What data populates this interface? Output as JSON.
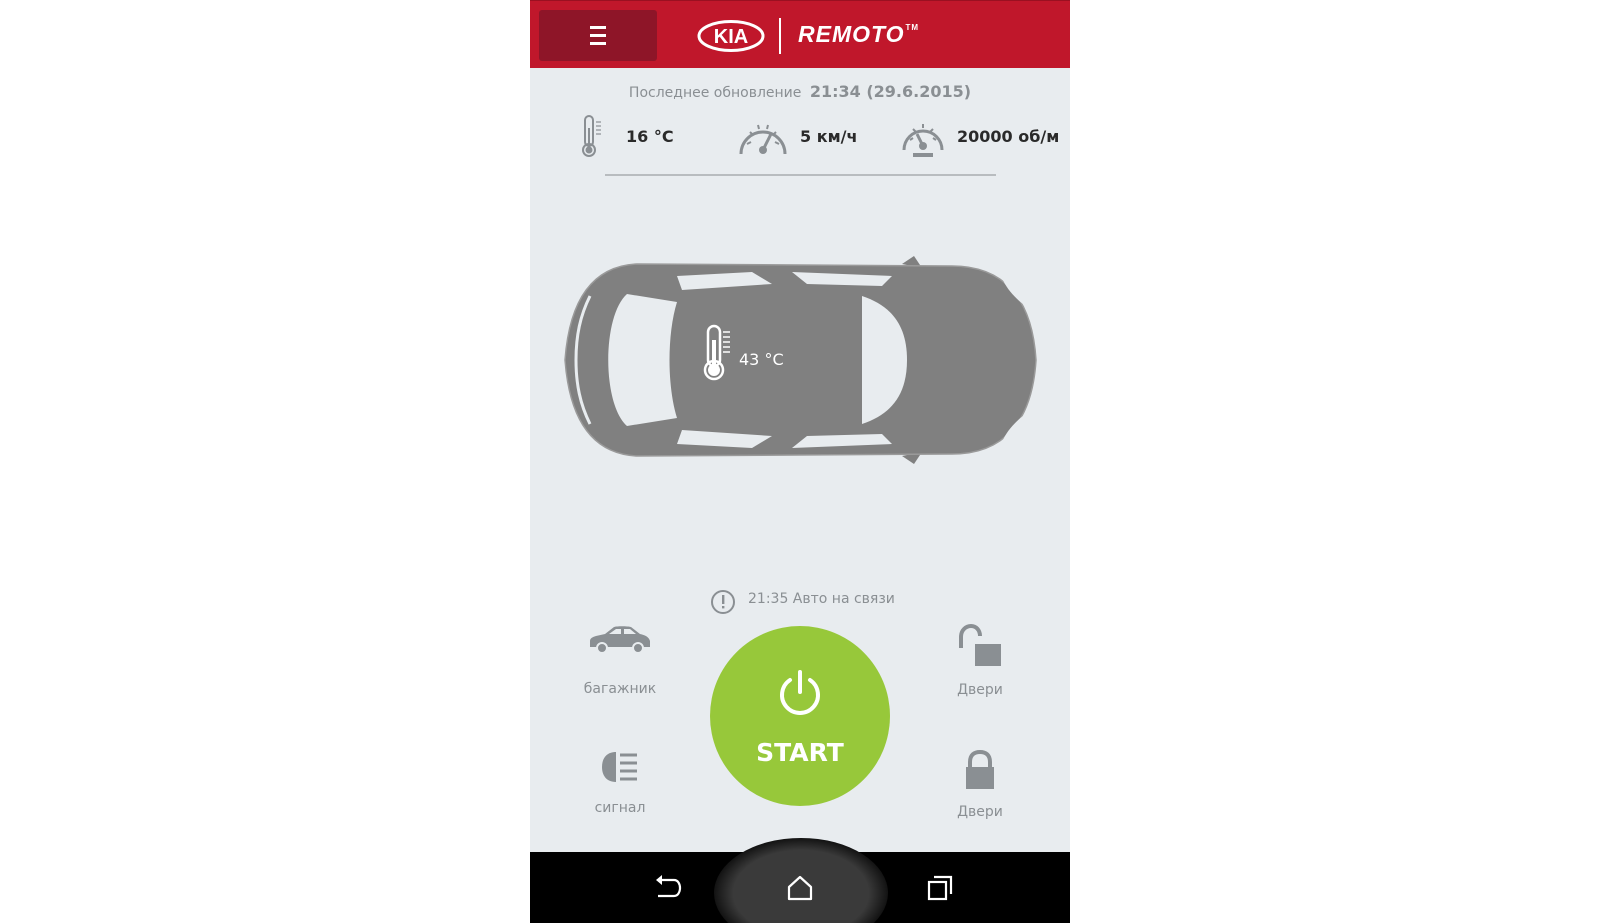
{
  "header": {
    "brand_logo_text": "KIA",
    "app_name": "REMOTO",
    "trademark": "TM"
  },
  "status": {
    "last_update_label": "Последнее обновление",
    "last_update_value": "21:34 (29.6.2015)",
    "outside_temp": "16 °C",
    "speed": "5 км/ч",
    "rpm": "20000 об/м",
    "cabin_temp": "43 °C"
  },
  "connection": {
    "text": "21:35 Авто на связи"
  },
  "controls": {
    "trunk_label": "багажник",
    "signal_label": "сигнал",
    "unlock_doors_label": "Двери",
    "lock_doors_label": "Двери",
    "start_label": "START"
  },
  "colors": {
    "header": "#c0172b",
    "menu_button": "#8e1528",
    "start_button": "#97c83a",
    "background": "#e8ecef",
    "icon_gray": "#8a8f93",
    "car_gray": "#808080"
  },
  "icons": {
    "menu": "hamburger-icon",
    "outside_temp": "thermometer-icon",
    "speed": "speedometer-icon",
    "rpm": "tachometer-icon",
    "connection": "alert-circle-icon",
    "trunk": "car-icon",
    "signal": "headlight-icon",
    "unlock": "unlock-icon",
    "lock": "lock-icon",
    "start": "power-icon",
    "back": "back-icon",
    "home": "home-icon",
    "recents": "recents-icon"
  }
}
